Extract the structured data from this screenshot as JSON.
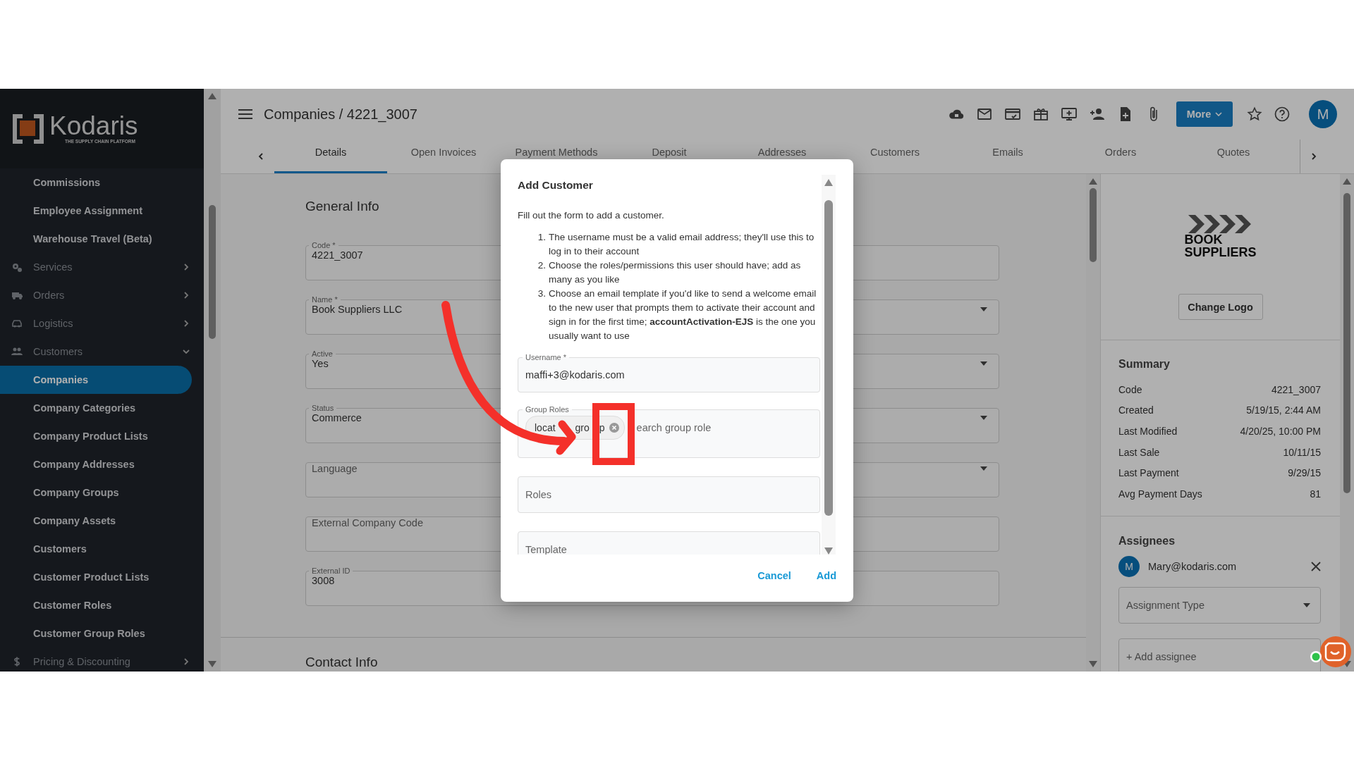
{
  "sidebar": {
    "logo": {
      "name": "Kodaris",
      "tagline": "THE SUPPLY CHAIN PLATFORM"
    },
    "items": [
      {
        "kind": "link",
        "label": "Commissions",
        "selected": false
      },
      {
        "kind": "link",
        "label": "Employee Assignment",
        "selected": false
      },
      {
        "kind": "link",
        "label": "Warehouse Travel (Beta)",
        "selected": false
      },
      {
        "kind": "group",
        "label": "Services",
        "expanded": false,
        "selected": false
      },
      {
        "kind": "group",
        "label": "Orders",
        "expanded": false,
        "selected": false
      },
      {
        "kind": "group",
        "label": "Logistics",
        "expanded": false,
        "selected": false
      },
      {
        "kind": "group",
        "label": "Customers",
        "expanded": true,
        "selected": false,
        "children": [
          {
            "label": "Companies",
            "selected": true
          },
          {
            "label": "Company Categories",
            "selected": false
          },
          {
            "label": "Company Product Lists",
            "selected": false
          },
          {
            "label": "Company Addresses",
            "selected": false
          },
          {
            "label": "Company Groups",
            "selected": false
          },
          {
            "label": "Company Assets",
            "selected": false
          },
          {
            "label": "Customers",
            "selected": false
          },
          {
            "label": "Customer Product Lists",
            "selected": false
          },
          {
            "label": "Customer Roles",
            "selected": false
          },
          {
            "label": "Customer Group Roles",
            "selected": false
          }
        ]
      },
      {
        "kind": "group",
        "label": "Pricing & Discounting",
        "expanded": false,
        "selected": false
      }
    ]
  },
  "header": {
    "breadcrumb": "Companies / 4221_3007",
    "toolbar_icons": [
      {
        "kind": "cloud"
      },
      {
        "kind": "mail"
      },
      {
        "kind": "card"
      },
      {
        "kind": "gift"
      },
      {
        "kind": "monitor"
      },
      {
        "kind": "person-add"
      },
      {
        "kind": "file-plus"
      },
      {
        "kind": "clip"
      }
    ],
    "more_button": "More",
    "avatar": "M"
  },
  "tabs": [
    {
      "label": "Details",
      "selected": true
    },
    {
      "label": "Open Invoices",
      "selected": false
    },
    {
      "label": "Payment Methods",
      "selected": false
    },
    {
      "label": "Deposit",
      "selected": false
    },
    {
      "label": "Addresses",
      "selected": false
    },
    {
      "label": "Customers",
      "selected": false
    },
    {
      "label": "Emails",
      "selected": false
    },
    {
      "label": "Orders",
      "selected": false
    },
    {
      "label": "Quotes",
      "selected": false
    }
  ],
  "general_info": {
    "title": "General Info",
    "fields": [
      {
        "label": "Code *",
        "value": "4221_3007",
        "dropdown": false
      },
      {
        "label": "Name *",
        "value": "Book Suppliers LLC",
        "dropdown": true
      },
      {
        "label": "Active",
        "value": "Yes",
        "dropdown": true
      },
      {
        "label": "Status",
        "value": "Commerce",
        "dropdown": true
      },
      {
        "placeholder": "Language",
        "dropdown": true
      },
      {
        "placeholder": "External Company Code",
        "dropdown": false
      },
      {
        "label": "External ID",
        "value": "3008",
        "dropdown": false
      }
    ]
  },
  "contact_info": {
    "title": "Contact Info"
  },
  "side_panel": {
    "logo_text": [
      "BOOK",
      "SUPPLIERS"
    ],
    "change_logo_button": "Change Logo",
    "summary": {
      "title": "Summary",
      "rows": [
        {
          "label": "Code",
          "value": "4221_3007"
        },
        {
          "label": "Created",
          "value": "5/19/15, 2:44 AM"
        },
        {
          "label": "Last Modified",
          "value": "4/20/25, 10:00 PM"
        },
        {
          "label": "Last Sale",
          "value": "10/11/15"
        },
        {
          "label": "Last Payment",
          "value": "9/29/15"
        },
        {
          "label": "Avg Payment Days",
          "value": "81"
        }
      ]
    },
    "assignees": {
      "title": "Assignees",
      "people": [
        {
          "avatar": "M",
          "email": "Mary@kodaris.com"
        }
      ],
      "assignment_type": {
        "placeholder": "Assignment Type"
      },
      "add_assignee": {
        "placeholder": "+ Add assignee"
      }
    }
  },
  "dialog": {
    "title": "Add Customer",
    "intro": "Fill out the form to add a customer.",
    "steps": [
      {
        "number": "1.",
        "text": "The username must be a valid email address; they'll use this to log in to their account"
      },
      {
        "number": "2.",
        "text": "Choose the roles/permissions this user should have; add as many as you like"
      },
      {
        "number": "3.",
        "text": "Choose an email template if you'd like to send a welcome email to the new user that prompts them to activate their account and sign in for the first time; **accountActivation-EJS** is the one you usually want to use"
      }
    ],
    "username": {
      "label": "Username *",
      "value": "maffi+3@kodaris.com"
    },
    "group_roles": {
      "label": "Group Roles",
      "chips": [
        {
          "fragments": [
            "locat",
            "gro",
            "p"
          ]
        }
      ],
      "placeholder": "earch group role"
    },
    "roles": {
      "placeholder": "Roles"
    },
    "template": {
      "placeholder": "Template"
    },
    "buttons": [
      "Cancel",
      "Add"
    ]
  }
}
